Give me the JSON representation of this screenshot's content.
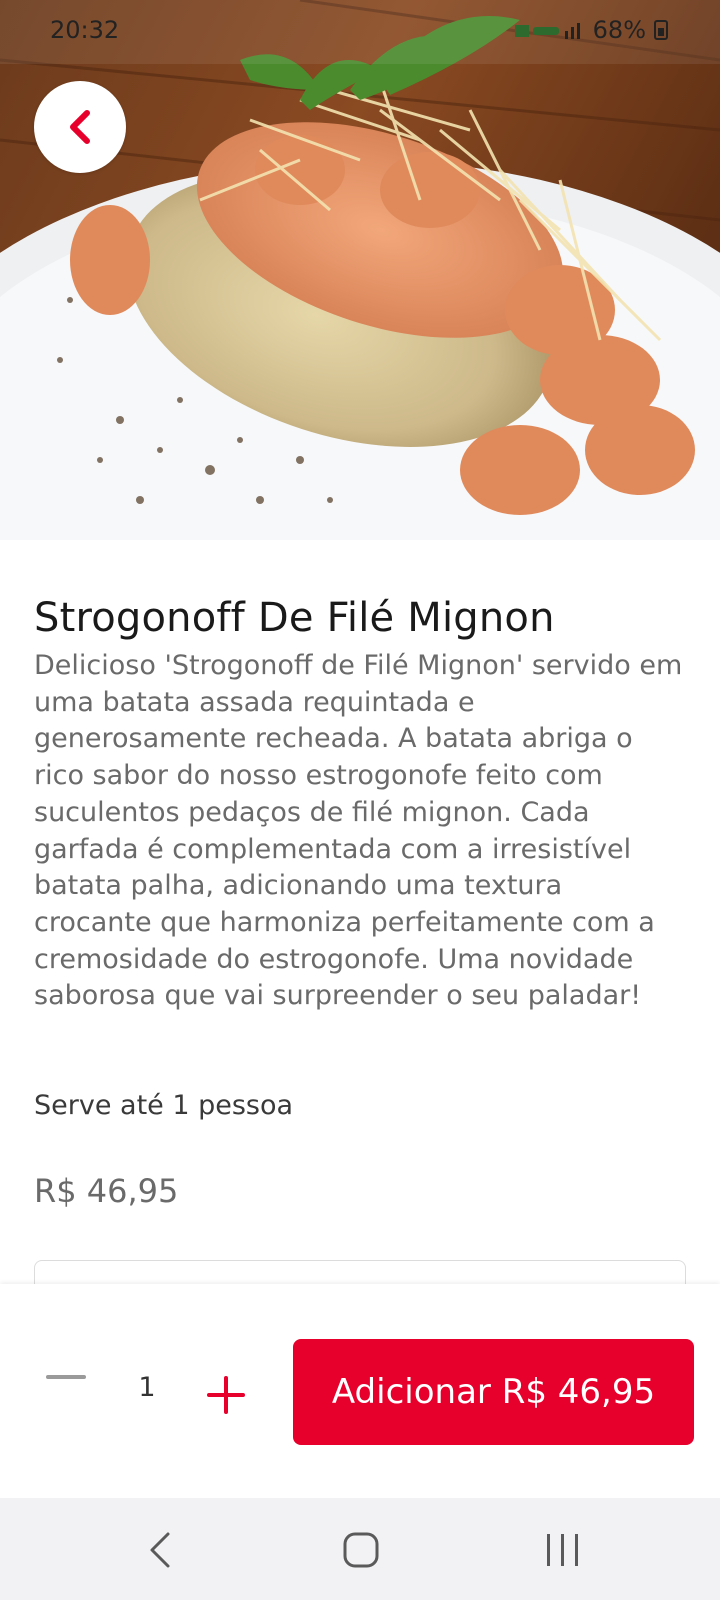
{
  "status_bar": {
    "time": "20:32",
    "battery": "68%"
  },
  "hero": {
    "icon": "food-photo"
  },
  "product": {
    "title": "Strogonoff De Filé Mignon",
    "description": "Delicioso 'Strogonoff de Filé Mignon' servido em uma batata assada requintada e generosamente recheada. A batata abriga o rico sabor do nosso estrogonofe feito com suculentos pedaços de filé mignon. Cada garfada é complementada com a irresistível batata palha, adicionando uma textura crocante que harmoniza perfeitamente com a cremosidade do estrogonofe. Uma novidade saborosa que vai surpreender o seu paladar!",
    "serves": "Serve até 1 pessoa",
    "price": "R$ 46,95"
  },
  "order": {
    "quantity": "1",
    "add_label": "Adicionar R$ 46,95"
  },
  "colors": {
    "accent": "#e7002c",
    "text_primary": "#1a1a1a",
    "text_secondary": "#6a6a6a",
    "nav_bg": "#f2f2f4"
  }
}
